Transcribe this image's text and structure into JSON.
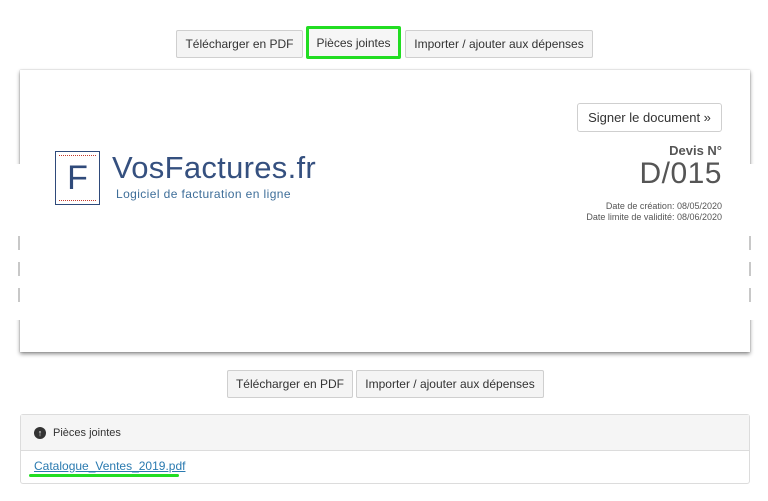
{
  "toolbar_top": {
    "pdf_label": "Télécharger en PDF",
    "attachments_label": "Pièces jointes",
    "import_label": "Importer / ajouter aux dépenses"
  },
  "document": {
    "sign_label": "Signer le document »",
    "logo_letter": "F",
    "logo_name": "VosFactures.fr",
    "logo_tagline": "Logiciel de facturation en ligne",
    "doc_type_label": "Devis N°",
    "doc_number": "D/015",
    "creation_date": "Date de création: 08/05/2020",
    "validity_date": "Date limite de validité: 08/06/2020"
  },
  "toolbar_bottom": {
    "pdf_label": "Télécharger en PDF",
    "import_label": "Importer / ajouter aux dépenses"
  },
  "attachments_panel": {
    "icon": "arrow-up-circle-icon",
    "title": "Pièces jointes",
    "files": [
      "Catalogue_Ventes_2019.pdf"
    ]
  },
  "colors": {
    "highlight": "#22dd22",
    "brand": "#35507f",
    "link": "#2a7ab0"
  }
}
